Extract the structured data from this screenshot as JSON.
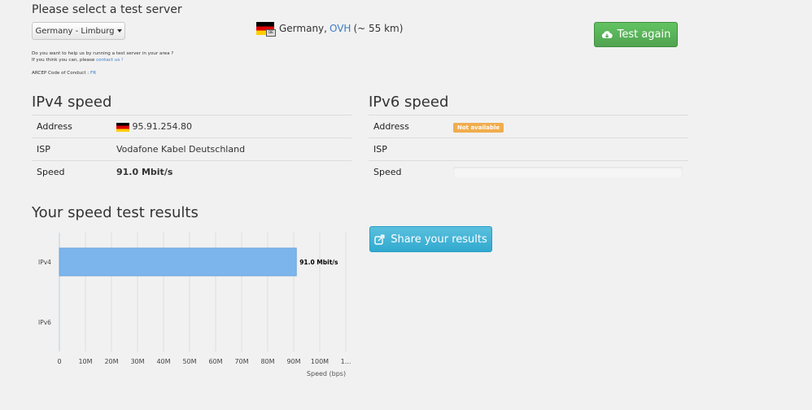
{
  "server": {
    "heading": "Please select a test server",
    "dropdown_value": "Germany - Limburg",
    "help_line1": "Do you want to help us by running a test server in your area ?",
    "help_line2": "If you think you can, please",
    "contact_link": "contact us !",
    "conduct_label": "ARCEP Code of Conduct :",
    "conduct_link": "FR",
    "location_country": "Germany,",
    "location_provider": "OVH",
    "location_distance": "(~ 55 km)",
    "flag_badge": "DE",
    "test_again_label": "Test again"
  },
  "ipv4": {
    "heading": "IPv4 speed",
    "rows": [
      {
        "label": "Address",
        "value": "95.91.254.80"
      },
      {
        "label": "ISP",
        "value": "Vodafone Kabel Deutschland"
      },
      {
        "label": "Speed",
        "value": "91.0 Mbit/s"
      }
    ]
  },
  "ipv6": {
    "heading": "IPv6 speed",
    "rows": [
      {
        "label": "Address",
        "value": "Not available"
      },
      {
        "label": "ISP",
        "value": ""
      },
      {
        "label": "Speed",
        "value": ""
      }
    ]
  },
  "results": {
    "heading": "Your speed test results",
    "share_label": "Share your results"
  },
  "colors": {
    "bar": "#7cb5ec",
    "green_button": "#5cb85c",
    "blue_button": "#5bc0de",
    "badge": "#f0ad4e",
    "link": "#3a7bc8"
  },
  "chart_data": {
    "type": "bar",
    "orientation": "horizontal",
    "categories": [
      "IPv4",
      "IPv6"
    ],
    "values": [
      91.0,
      null
    ],
    "data_labels": [
      "91.0 Mbit/s",
      ""
    ],
    "xlabel": "Speed (bps)",
    "xticks": [
      "0",
      "10M",
      "20M",
      "30M",
      "40M",
      "50M",
      "60M",
      "70M",
      "80M",
      "90M",
      "100M",
      "1..."
    ],
    "xlim": [
      0,
      110
    ],
    "grid": true
  }
}
